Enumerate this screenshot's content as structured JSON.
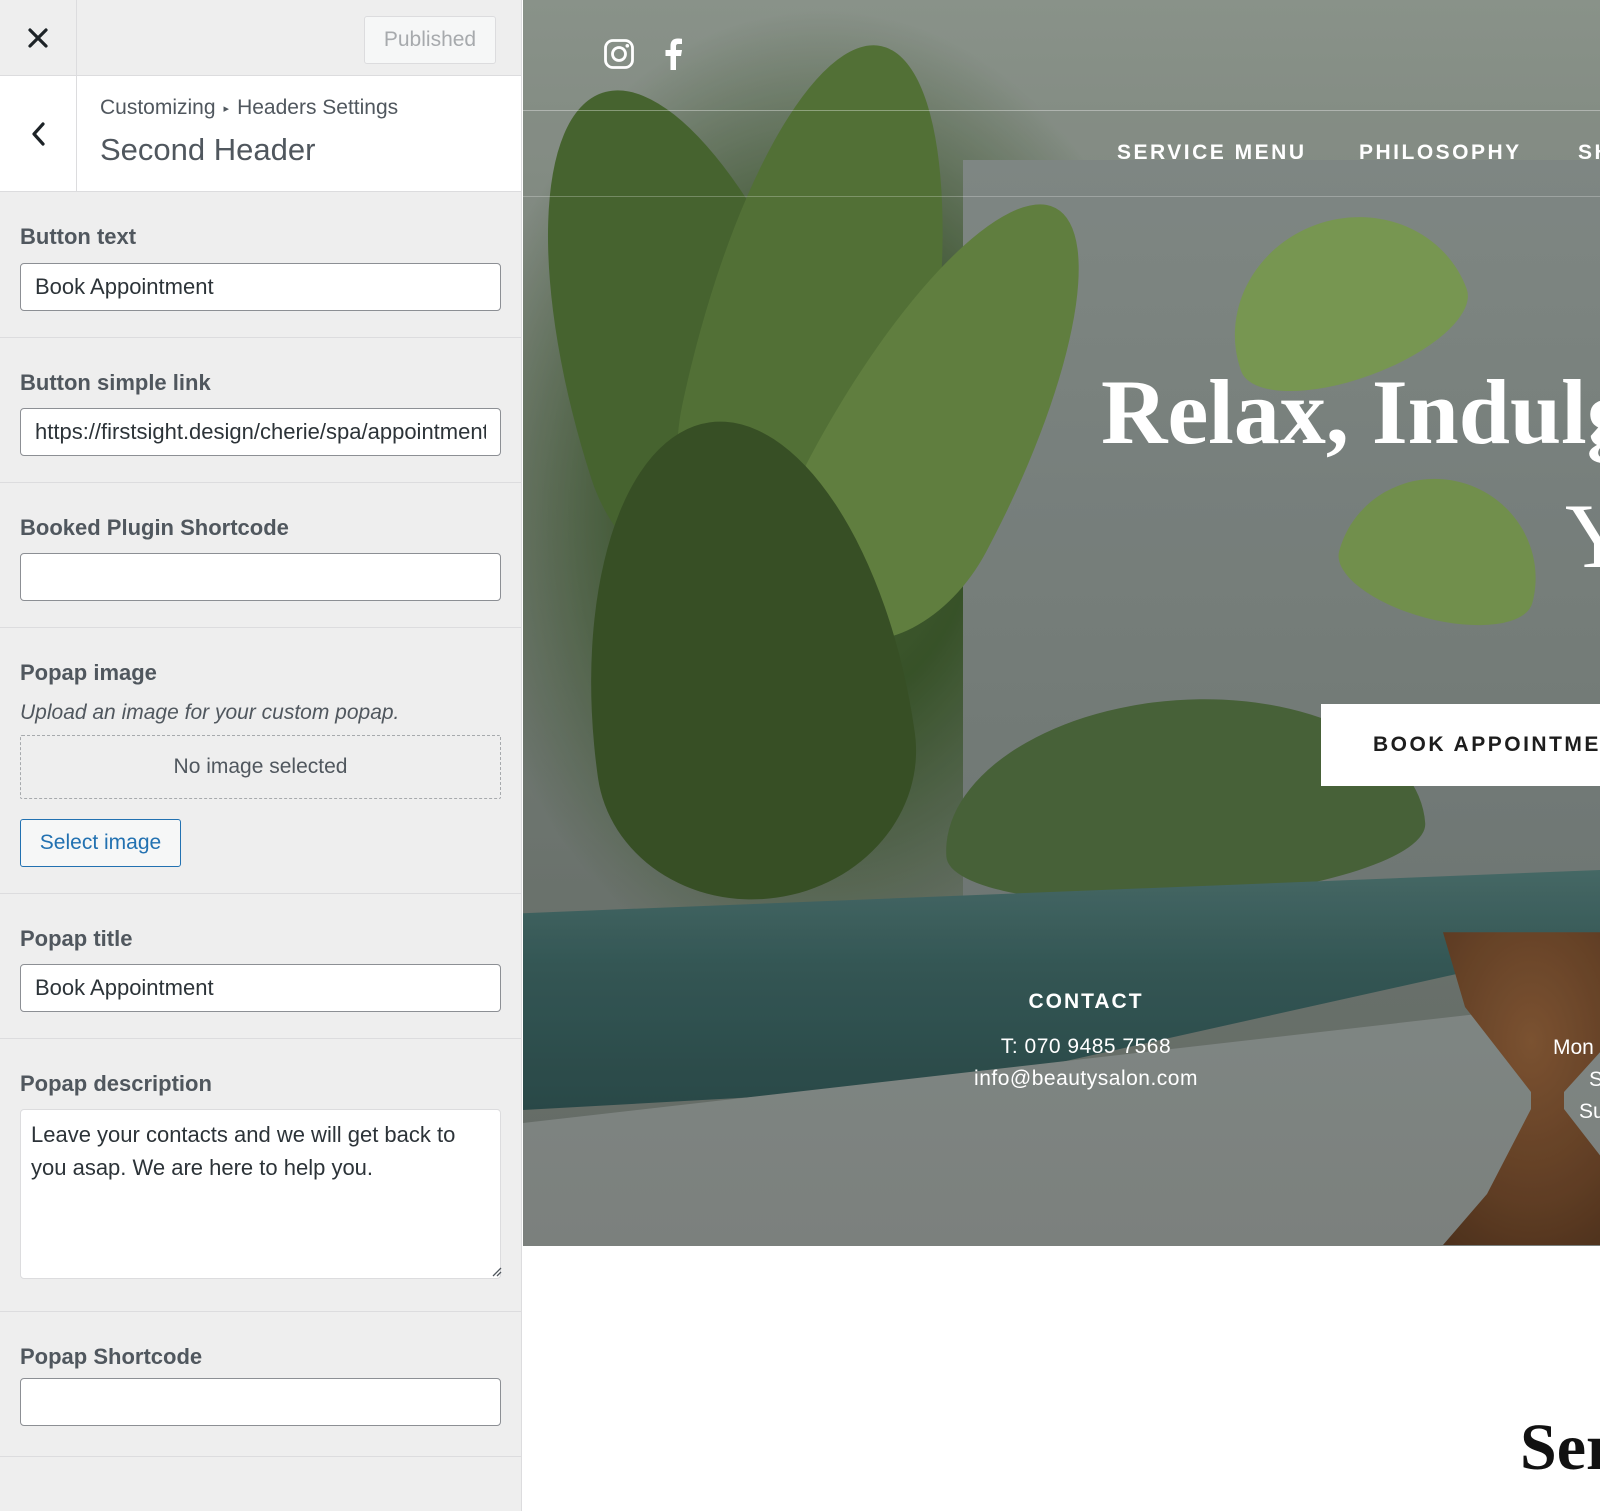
{
  "topbar": {
    "close_label": "×",
    "publish_label": "Published"
  },
  "section": {
    "breadcrumb_root": "Customizing",
    "breadcrumb_sep": "▸",
    "breadcrumb_parent": "Headers Settings",
    "title": "Second Header"
  },
  "controls": {
    "button_text": {
      "label": "Button text",
      "value": "Book Appointment"
    },
    "button_link": {
      "label": "Button simple link",
      "value": "https://firstsight.design/cherie/spa/appointment/"
    },
    "booked_shortcode": {
      "label": "Booked Plugin Shortcode",
      "value": ""
    },
    "popap_image": {
      "label": "Popap image",
      "description": "Upload an image for your custom popap.",
      "placeholder": "No image selected",
      "select_label": "Select image"
    },
    "popap_title": {
      "label": "Popap title",
      "value": "Book Appointment"
    },
    "popap_description": {
      "label": "Popap description",
      "value": "Leave your contacts and we will get back to you asap. We are here to help you."
    },
    "popap_shortcode": {
      "label": "Popap Shortcode",
      "value": ""
    }
  },
  "preview": {
    "social": [
      "instagram-icon",
      "facebook-icon"
    ],
    "nav": [
      "SERVICE MENU",
      "PHILOSOPHY",
      "SH"
    ],
    "hero_title_line1": "Relax, Indulg",
    "hero_title_line2": "Yo",
    "book_button": "BOOK APPOINTME",
    "contact": {
      "title": "CONTACT",
      "phone": "T: 070 9485 7568",
      "email": "info@beautysalon.com"
    },
    "hours": [
      "Mon",
      "S",
      "Su"
    ],
    "services_heading": "Ser"
  },
  "colors": {
    "sidebar_bg": "#eeeeee",
    "accent": "#2271b1",
    "text": "#50575e"
  }
}
